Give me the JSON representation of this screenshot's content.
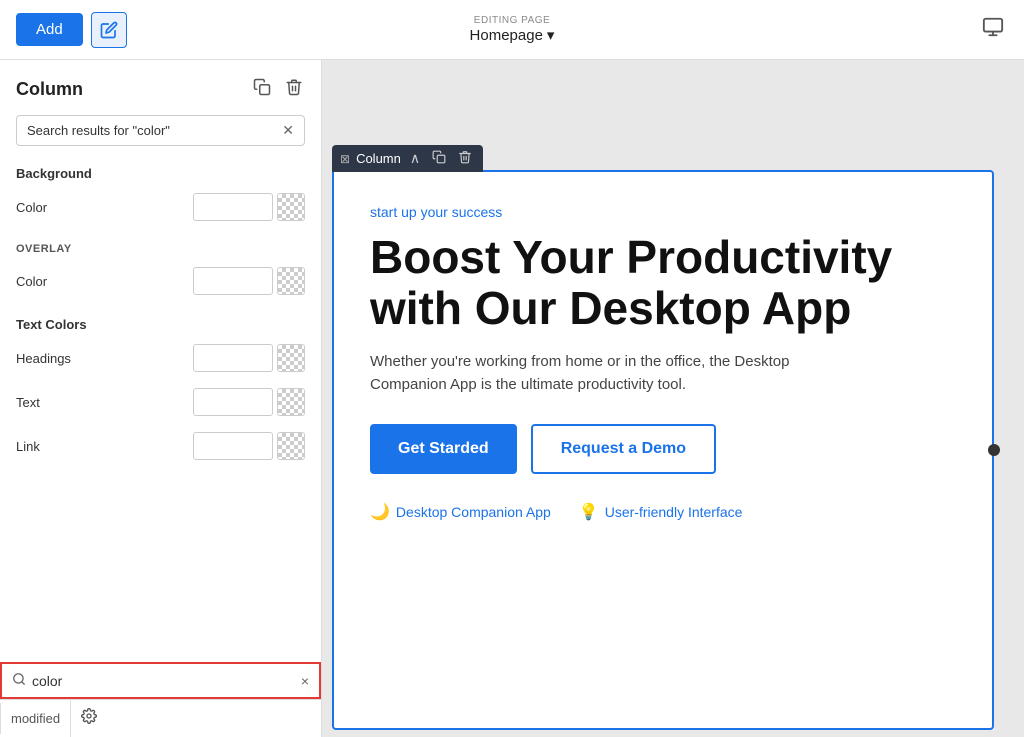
{
  "toolbar": {
    "add_label": "Add",
    "editing_page_label": "EDITING PAGE",
    "homepage_label": "Homepage",
    "chevron_down": "▾"
  },
  "left_panel": {
    "title": "Column",
    "search_query": "Search results for \"color\"",
    "sections": {
      "background_label": "Background",
      "background_color_label": "Color",
      "overlay_label": "OVERLAY",
      "overlay_color_label": "Color",
      "text_colors_label": "Text Colors",
      "headings_label": "Headings",
      "text_label": "Text",
      "link_label": "Link"
    }
  },
  "bottom_bar": {
    "search_value": "color",
    "modified_label": "modified",
    "clear_label": "×"
  },
  "canvas": {
    "column_toolbar_label": "Column",
    "tagline": "start up your success",
    "heading": "Boost Your Productivity with Our Desktop App",
    "description": "Whether you're working from home or in the office, the Desktop Companion App is the ultimate productivity tool.",
    "btn_get_started": "Get Starded",
    "btn_request_demo": "Request a Demo",
    "feature1": "Desktop Companion App",
    "feature2": "User-friendly Interface"
  }
}
